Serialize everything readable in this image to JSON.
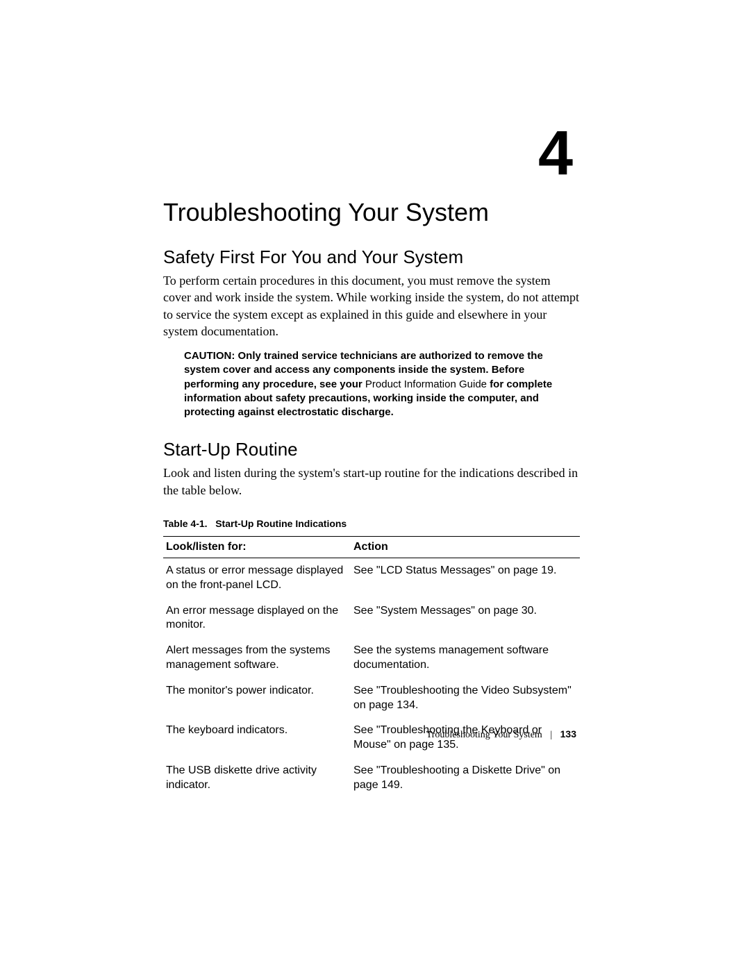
{
  "chapter": {
    "number": "4",
    "title": "Troubleshooting Your System"
  },
  "section1": {
    "title": "Safety First For You and Your System",
    "paragraph": "To perform certain procedures in this document, you must remove the system cover and work inside the system. While working inside the system, do not attempt to service the system except as explained in this guide and elsewhere in your system documentation."
  },
  "caution": {
    "label": "CAUTION:",
    "part1": " Only trained service technicians are authorized to remove the system cover and access any components inside the system. Before performing any procedure, see your ",
    "nonbold": "Product Information Guide",
    "part2": " for complete information about safety precautions, working inside the computer, and protecting against electrostatic discharge."
  },
  "section2": {
    "title": "Start-Up Routine",
    "paragraph": "Look and listen during the system's start-up routine for the indications described in the table below."
  },
  "table": {
    "caption_prefix": "Table 4-1.",
    "caption_title": "Start-Up Routine Indications",
    "head_col1": "Look/listen for:",
    "head_col2": "Action",
    "rows": [
      {
        "c1": "A status or error message displayed on the front-panel LCD.",
        "c2": "See \"LCD Status Messages\" on page 19."
      },
      {
        "c1": "An error message displayed on the monitor.",
        "c2": "See \"System Messages\" on page 30."
      },
      {
        "c1": "Alert messages from the systems management software.",
        "c2": "See the systems management software documentation."
      },
      {
        "c1": "The monitor's power indicator.",
        "c2": "See \"Troubleshooting the Video Subsystem\" on page 134."
      },
      {
        "c1": "The keyboard indicators.",
        "c2": "See \"Troubleshooting the Keyboard or Mouse\" on page 135."
      },
      {
        "c1": "The USB diskette drive activity indicator.",
        "c2": "See \"Troubleshooting a Diskette Drive\" on page 149."
      }
    ]
  },
  "footer": {
    "text": "Troubleshooting Your System",
    "page": "133"
  }
}
